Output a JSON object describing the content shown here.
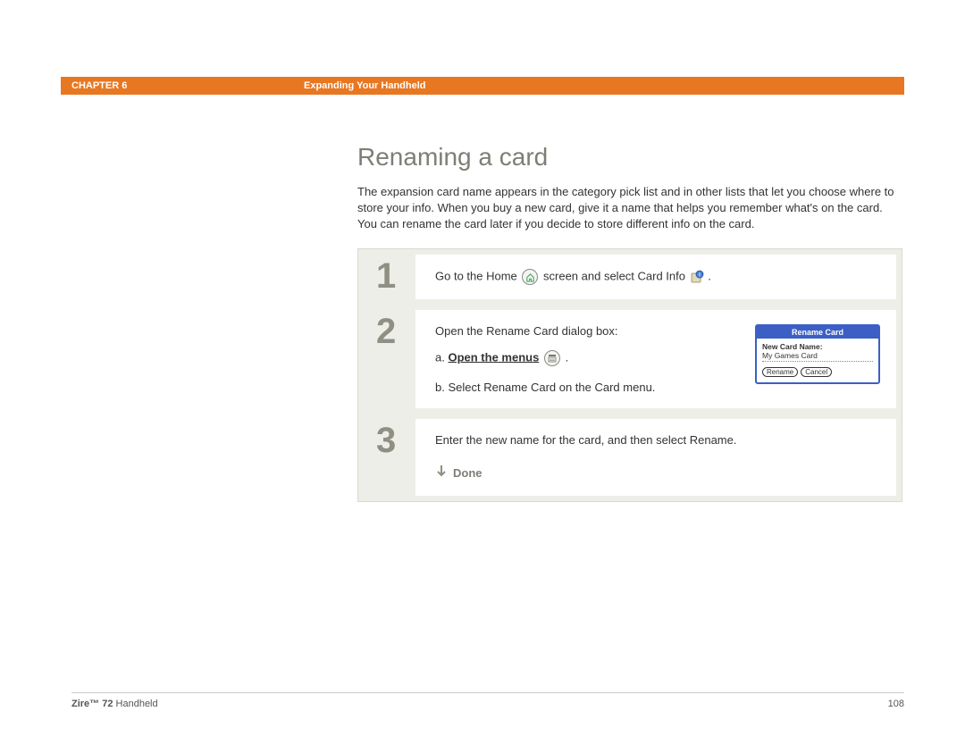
{
  "header": {
    "chapter_label": "CHAPTER 6",
    "chapter_title": "Expanding Your Handheld"
  },
  "section": {
    "title": "Renaming a card",
    "intro": "The expansion card name appears in the category pick list and in other lists that let you choose where to store your info. When you buy a new card, give it a name that helps you remember what's on the card. You can rename the card later if you decide to store different info on the card."
  },
  "steps": [
    {
      "num": "1",
      "text_pre": "Go to the Home ",
      "text_mid": " screen and select Card Info ",
      "text_post": "."
    },
    {
      "num": "2",
      "intro": "Open the Rename Card dialog box:",
      "sub_a_prefix": "a.  ",
      "sub_a_link": "Open the menus",
      "sub_a_suffix": " .",
      "sub_b": "b.  Select Rename Card on the Card menu.",
      "dialog": {
        "title": "Rename Card",
        "label": "New Card Name:",
        "value": "My Games Card",
        "btn_rename": "Rename",
        "btn_cancel": "Cancel"
      }
    },
    {
      "num": "3",
      "text": "Enter the new name for the card, and then select Rename.",
      "done": "Done"
    }
  ],
  "footer": {
    "product_bold": "Zire™ 72",
    "product_rest": " Handheld",
    "page": "108"
  }
}
